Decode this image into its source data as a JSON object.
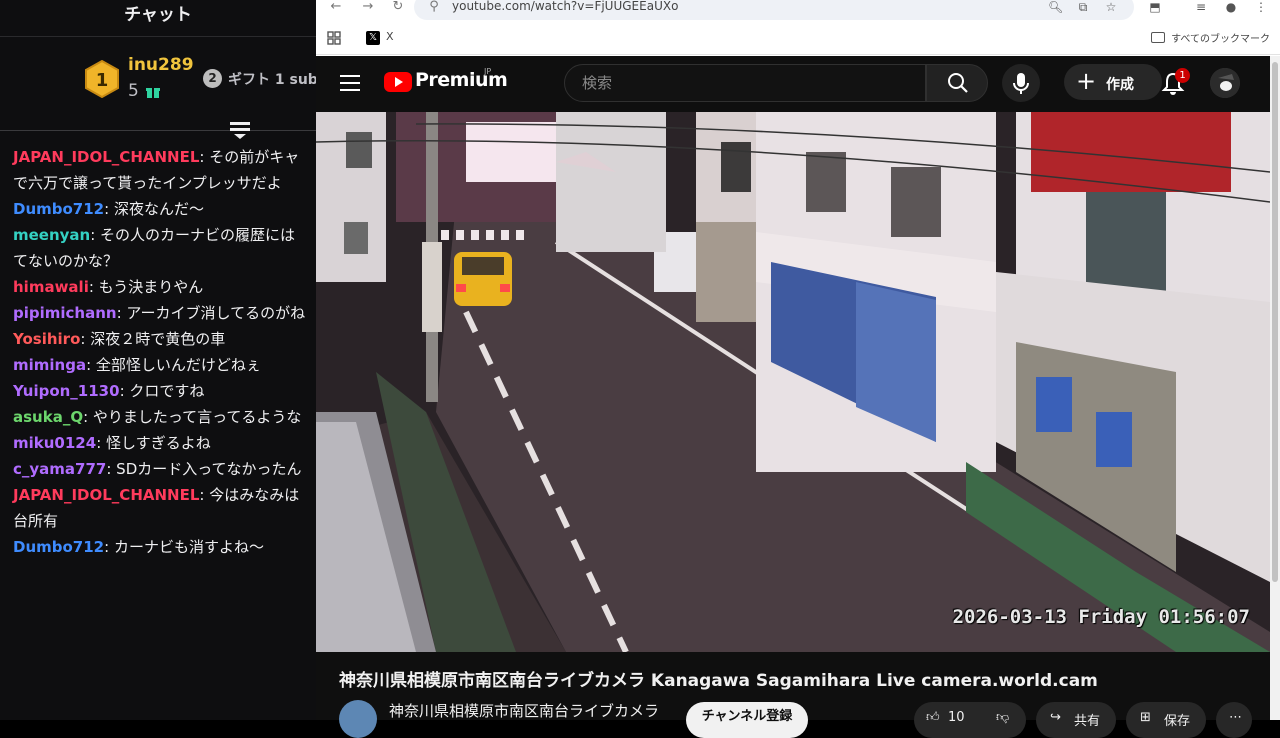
{
  "chat": {
    "title": "チャット",
    "gift": {
      "user": "inu289",
      "count": "5",
      "badge_num": "2",
      "text": "ギフト 1 sub"
    },
    "messages": [
      {
        "user": "JAPAN_IDOL_CHANNEL",
        "color": "#ff3b5c",
        "text": ": その前がキャ",
        "cont": "で六万で譲って貰ったインプレッサだよ"
      },
      {
        "user": "Dumbo712",
        "color": "#3f8cff",
        "text": ": 深夜なんだ〜"
      },
      {
        "user": "meenyan",
        "color": "#34d1c3",
        "text": ": その人のカーナビの履歴には",
        "cont": "てないのかな？"
      },
      {
        "user": "himawali",
        "color": "#ff3b5c",
        "text": ": もう決まりやん"
      },
      {
        "user": "pipimichann",
        "color": "#b06cff",
        "text": ": アーカイブ消してるのがね"
      },
      {
        "user": "Yosihiro",
        "color": "#ff5a5a",
        "text": ": 深夜２時で黄色の車"
      },
      {
        "user": "mimingа",
        "color": "#b06cff",
        "text": ": 全部怪しいんだけどねぇ"
      },
      {
        "user": "Yuipon_1130",
        "color": "#b06cff",
        "text": ": クロですね"
      },
      {
        "user": "asuka_Q",
        "color": "#6cd66c",
        "text": ": やりましたって言ってるような"
      },
      {
        "user": "miku0124",
        "color": "#b06cff",
        "text": ": 怪しすぎるよね"
      },
      {
        "user": "c_yama777",
        "color": "#b06cff",
        "text": ": SDカード入ってなかったん"
      },
      {
        "user": "JAPAN_IDOL_CHANNEL",
        "color": "#ff3b5c",
        "text": ": 今はみなみは",
        "cont": "台所有"
      },
      {
        "user": "Dumbo712",
        "color": "#3f8cff",
        "text": ": カーナビも消すよね〜"
      }
    ]
  },
  "browser": {
    "url": "youtube.com/watch?v=FjUUGEEaUXo",
    "bookmark_x": "X",
    "all_bookmarks": "すべてのブックマーク"
  },
  "youtube": {
    "brand": "Premium",
    "region": "JP",
    "search_placeholder": "検索",
    "create_label": "作成",
    "notification_count": "1",
    "video_timestamp": "2026-03-13 Friday 01:56:07",
    "video_title": "神奈川県相模原市南区南台ライブカメラ Kanagawa Sagamihara Live camera.world.cam",
    "channel_name": "神奈川県相模原市南区南台ライブカメラ",
    "subscribe_label": "チャンネル登録",
    "like_count": "10",
    "share_label": "共有",
    "save_label": "保存",
    "accent": "#ff0000"
  }
}
